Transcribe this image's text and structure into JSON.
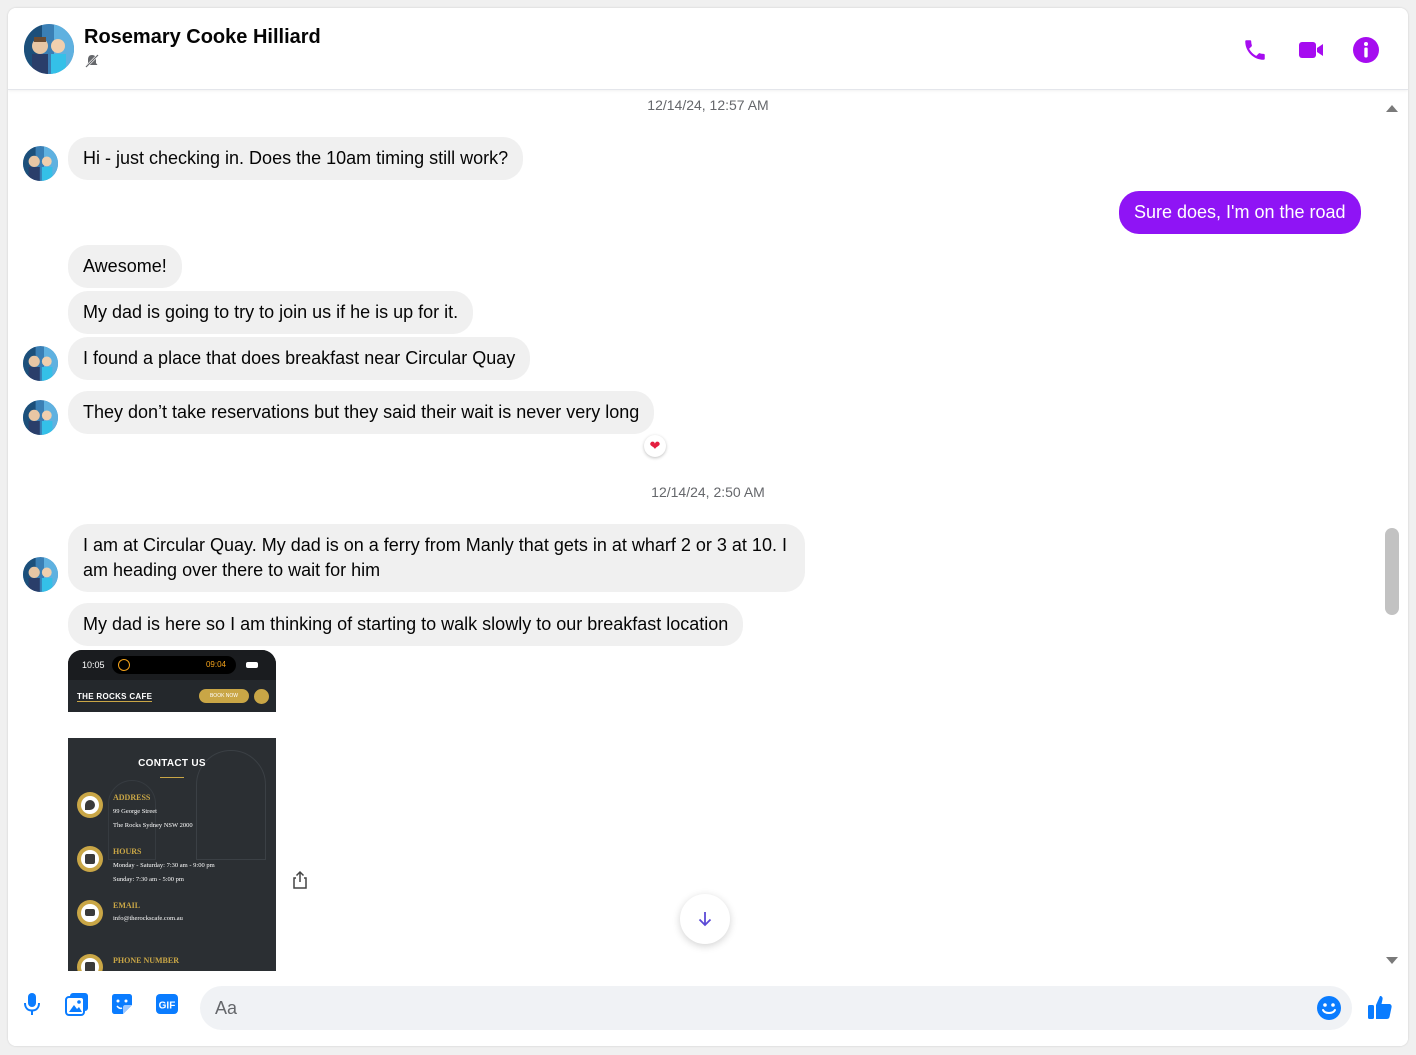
{
  "header": {
    "contact_name": "Rosemary Cooke Hilliard",
    "status_icon": "muted-bell-icon",
    "actions": [
      {
        "name": "audio-call",
        "icon": "phone-icon"
      },
      {
        "name": "video-call",
        "icon": "video-camera-icon"
      },
      {
        "name": "conversation-info",
        "icon": "info-icon"
      }
    ],
    "accent_color": "#a60cf0"
  },
  "messages": {
    "timestamp_1": "12/14/24, 12:57 AM",
    "msg_1": "Hi - just checking in. Does the 10am timing still work?",
    "msg_2_mine": "Sure does, I'm on the road",
    "msg_3": "Awesome!",
    "msg_4": "My dad is going to try to join us if he is up for it.",
    "msg_5": "I found a place that does breakfast near Circular Quay",
    "msg_6": "They don’t take reservations but they said their wait is never very long",
    "msg_6_reaction": "❤",
    "timestamp_2": "12/14/24, 2:50 AM",
    "msg_7": "I am at Circular Quay. My dad is on a ferry from Manly that gets in at wharf 2 or 3 at 10. I am heading over there to wait for him",
    "msg_8": "My dad is here so I am thinking of starting to walk slowly to our breakfast location",
    "my_bubble_color": "#8f14f5",
    "their_bubble_color": "#f0f0f0"
  },
  "attachment": {
    "phone_time": "10:05",
    "timer": "09:04",
    "brand": "THE ROCKS CAFE",
    "book_button": "BOOK NOW",
    "section_title": "CONTACT US",
    "address_label": "ADDRESS",
    "address_line1": "99 George Street",
    "address_line2": "The Rocks Sydney NSW 2000",
    "hours_label": "HOURS",
    "hours_line1": "Monday - Saturday: 7:30 am - 9:00 pm",
    "hours_line2": "Sunday: 7:30 am - 5:00 pm",
    "email_label": "EMAIL",
    "email_value": "info@therockscafe.com.au",
    "phone_label": "PHONE NUMBER"
  },
  "composer": {
    "placeholder": "Aa",
    "icons": [
      "microphone-icon",
      "photo-icon",
      "sticker-icon",
      "gif-icon",
      "emoji-icon",
      "thumbs-up-icon"
    ],
    "gif_label": "GIF",
    "icon_color": "#0a7cff"
  }
}
